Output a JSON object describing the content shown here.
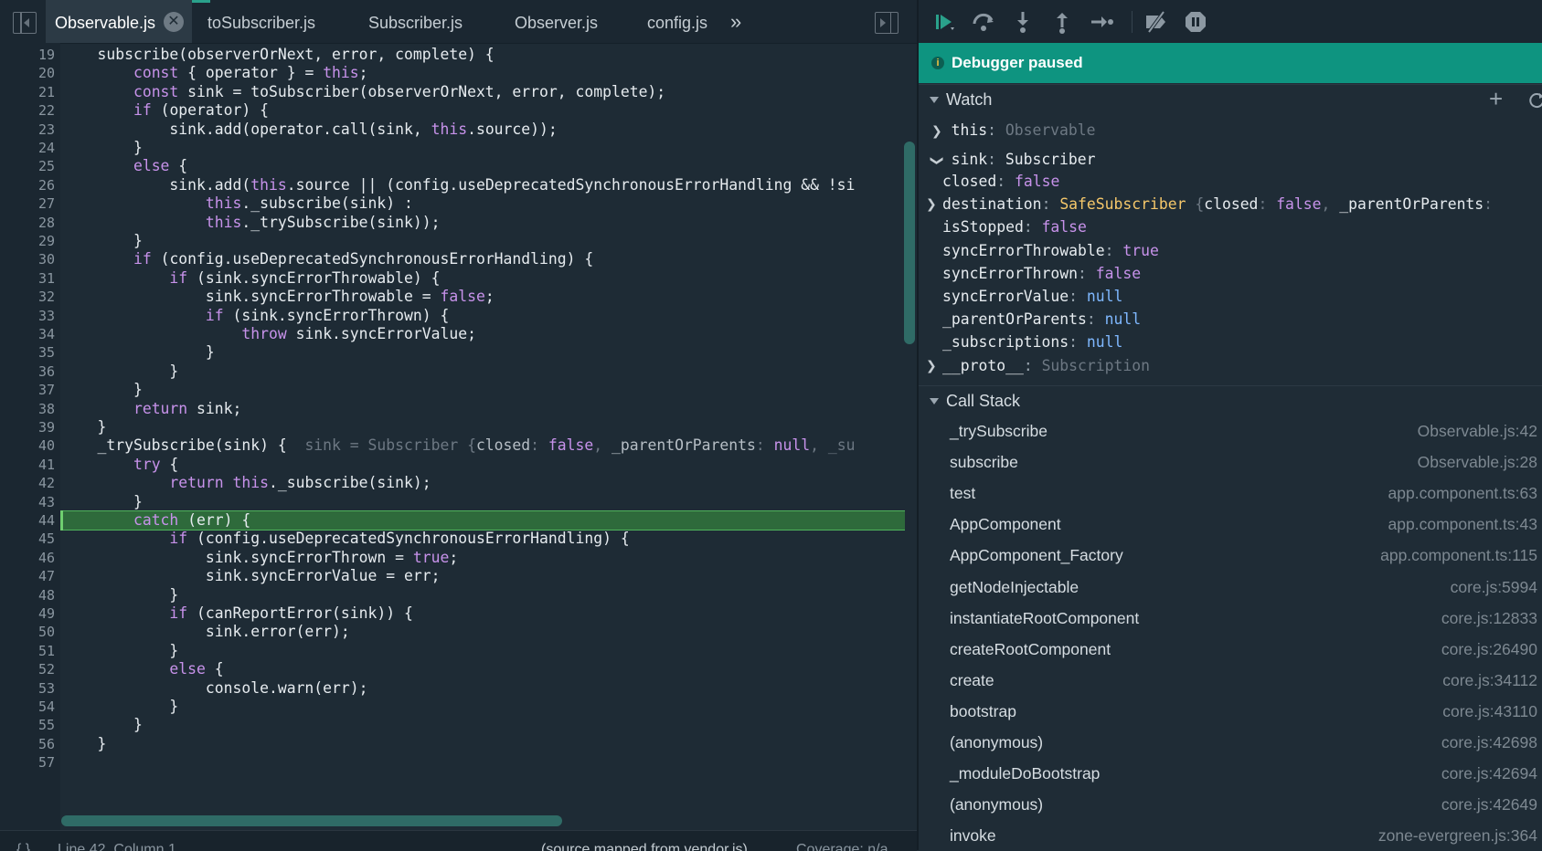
{
  "editor": {
    "tabs": [
      {
        "label": "Observable.js",
        "active": true
      },
      {
        "label": "toSubscriber.js"
      },
      {
        "label": "Subscriber.js"
      },
      {
        "label": "Observer.js"
      },
      {
        "label": "config.js"
      }
    ],
    "more_tabs": "»",
    "tab_close": "✕",
    "line_numbers": [
      "19",
      "20",
      "21",
      "22",
      "23",
      "24",
      "25",
      "26",
      "27",
      "28",
      "29",
      "30",
      "31",
      "32",
      "33",
      "34",
      "35",
      "36",
      "37",
      "38",
      "39",
      "40",
      "41",
      "42",
      "43",
      "44",
      "45",
      "46",
      "47",
      "48",
      "49",
      "50",
      "51",
      "52",
      "53",
      "54",
      "55",
      "56",
      "57"
    ],
    "code_lines": [
      "    subscribe(observerOrNext, error, complete) {",
      "        const { operator } = this;",
      "        const sink = toSubscriber(observerOrNext, error, complete);",
      "        if (operator) {",
      "            sink.add(operator.call(sink, this.source));",
      "        }",
      "        else {",
      "            sink.add(this.source || (config.useDeprecatedSynchronousErrorHandling && !si",
      "                this._subscribe(sink) :",
      "                this._trySubscribe(sink));",
      "        }",
      "        if (config.useDeprecatedSynchronousErrorHandling) {",
      "            if (sink.syncErrorThrowable) {",
      "                sink.syncErrorThrowable = false;",
      "                if (sink.syncErrorThrown) {",
      "                    throw sink.syncErrorValue;",
      "                }",
      "            }",
      "        }",
      "        return sink;",
      "    }",
      "    _trySubscribe(sink) {",
      "        try {",
      "            return this._subscribe(sink);",
      "        }",
      "        catch (err) {",
      "            if (config.useDeprecatedSynchronousErrorHandling) {",
      "                sink.syncErrorThrown = true;",
      "                sink.syncErrorValue = err;",
      "            }",
      "            if (canReportError(sink)) {",
      "                sink.error(err);",
      "            }",
      "            else {",
      "                console.warn(err);",
      "            }",
      "        }",
      "    }",
      "    "
    ],
    "inline_value": {
      "prefix": "sink = Subscriber {",
      "k1": "closed",
      "v1": "false",
      "k2": "_parentOrParents",
      "v2": "null",
      "tail": ", _su"
    },
    "status": {
      "braces": "{ }",
      "cursor": "Line 42, Column 1",
      "source_map": "(source mapped from vendor.js)",
      "coverage": "Coverage: n/a"
    }
  },
  "debugger": {
    "paused_text": "Debugger paused",
    "paused_icon": "i",
    "watch": {
      "header": "Watch",
      "add_icon": "+",
      "this_name": "this",
      "this_value": "Observable",
      "sink_name": "sink",
      "sink_value": "Subscriber",
      "props": [
        {
          "name": "closed",
          "value": "false",
          "kind": "bool"
        },
        {
          "name": "destination",
          "value": "SafeSubscriber",
          "kind": "obj",
          "preview": "{closed: false, _parentOrParents:"
        },
        {
          "name": "isStopped",
          "value": "false",
          "kind": "bool"
        },
        {
          "name": "syncErrorThrowable",
          "value": "true",
          "kind": "bool"
        },
        {
          "name": "syncErrorThrown",
          "value": "false",
          "kind": "bool"
        },
        {
          "name": "syncErrorValue",
          "value": "null",
          "kind": "null"
        },
        {
          "name": "_parentOrParents",
          "value": "null",
          "kind": "null"
        },
        {
          "name": "_subscriptions",
          "value": "null",
          "kind": "null"
        },
        {
          "name": "__proto__",
          "value": "Subscription",
          "kind": "dim"
        }
      ]
    },
    "call_stack": {
      "header": "Call Stack",
      "frames": [
        {
          "fn": "_trySubscribe",
          "loc": "Observable.js:42"
        },
        {
          "fn": "subscribe",
          "loc": "Observable.js:28"
        },
        {
          "fn": "test",
          "loc": "app.component.ts:63"
        },
        {
          "fn": "AppComponent",
          "loc": "app.component.ts:43"
        },
        {
          "fn": "AppComponent_Factory",
          "loc": "app.component.ts:115"
        },
        {
          "fn": "getNodeInjectable",
          "loc": "core.js:5994"
        },
        {
          "fn": "instantiateRootComponent",
          "loc": "core.js:12833"
        },
        {
          "fn": "createRootComponent",
          "loc": "core.js:26490"
        },
        {
          "fn": "create",
          "loc": "core.js:34112"
        },
        {
          "fn": "bootstrap",
          "loc": "core.js:43110"
        },
        {
          "fn": "(anonymous)",
          "loc": "core.js:42698"
        },
        {
          "fn": "_moduleDoBootstrap",
          "loc": "core.js:42694"
        },
        {
          "fn": "(anonymous)",
          "loc": "core.js:42649"
        },
        {
          "fn": "invoke",
          "loc": "zone-evergreen.js:364"
        }
      ]
    }
  }
}
